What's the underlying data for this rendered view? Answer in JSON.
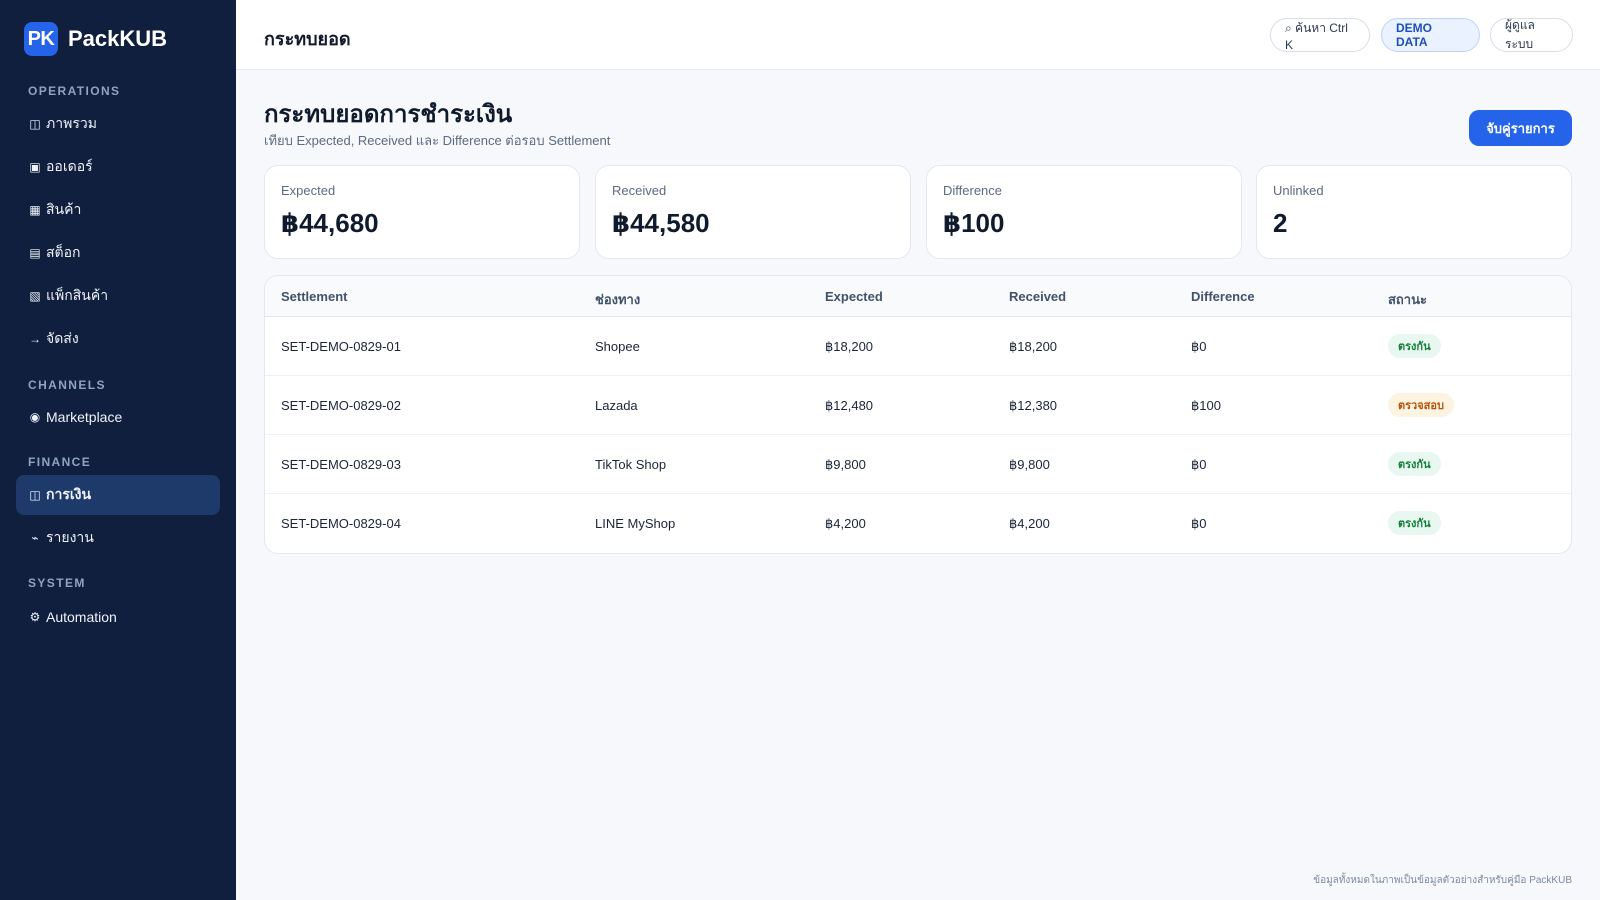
{
  "brand": {
    "mark": "PK",
    "name": "PackKUB"
  },
  "sidebar": {
    "sections": [
      {
        "label": "OPERATIONS"
      },
      {
        "label": "CHANNELS"
      },
      {
        "label": "FINANCE"
      },
      {
        "label": "SYSTEM"
      }
    ],
    "items": [
      {
        "icon": "◫",
        "label": "ภาพรวม"
      },
      {
        "icon": "▣",
        "label": "ออเดอร์"
      },
      {
        "icon": "▦",
        "label": "สินค้า"
      },
      {
        "icon": "▤",
        "label": "สต็อก"
      },
      {
        "icon": "▧",
        "label": "แพ็กสินค้า"
      },
      {
        "icon": "→",
        "label": "จัดส่ง"
      },
      {
        "icon": "◉",
        "label": "Marketplace"
      },
      {
        "icon": "◫",
        "label": "การเงิน"
      },
      {
        "icon": "⌁",
        "label": "รายงาน"
      },
      {
        "icon": "⚙",
        "label": "Automation"
      }
    ]
  },
  "topbar": {
    "title": "กระทบยอด",
    "search_label": "⌕ ค้นหา Ctrl K",
    "demo_label": "DEMO DATA",
    "user_label": "ผู้ดูแลระบบ"
  },
  "page": {
    "title": "กระทบยอดการชำระเงิน",
    "subtitle": "เทียบ Expected, Received และ Difference ต่อรอบ Settlement",
    "action_label": "จับคู่รายการ"
  },
  "cards": [
    {
      "label": "Expected",
      "value": "฿44,680"
    },
    {
      "label": "Received",
      "value": "฿44,580"
    },
    {
      "label": "Difference",
      "value": "฿100"
    },
    {
      "label": "Unlinked",
      "value": "2"
    }
  ],
  "table": {
    "headers": [
      "Settlement",
      "ช่องทาง",
      "Expected",
      "Received",
      "Difference",
      "สถานะ"
    ],
    "rows": [
      {
        "settlement": "SET-DEMO-0829-01",
        "channel": "Shopee",
        "expected": "฿18,200",
        "received": "฿18,200",
        "difference": "฿0",
        "status": "ตรงกัน",
        "status_type": "ok"
      },
      {
        "settlement": "SET-DEMO-0829-02",
        "channel": "Lazada",
        "expected": "฿12,480",
        "received": "฿12,380",
        "difference": "฿100",
        "status": "ตรวจสอบ",
        "status_type": "warn"
      },
      {
        "settlement": "SET-DEMO-0829-03",
        "channel": "TikTok Shop",
        "expected": "฿9,800",
        "received": "฿9,800",
        "difference": "฿0",
        "status": "ตรงกัน",
        "status_type": "ok"
      },
      {
        "settlement": "SET-DEMO-0829-04",
        "channel": "LINE MyShop",
        "expected": "฿4,200",
        "received": "฿4,200",
        "difference": "฿0",
        "status": "ตรงกัน",
        "status_type": "ok"
      }
    ]
  },
  "footer": {
    "note": "ข้อมูลทั้งหมดในภาพเป็นข้อมูลตัวอย่างสำหรับคู่มือ PackKUB"
  },
  "colors": {
    "sidebar": "#0f1f3d",
    "accent": "#2563eb",
    "ok": "#15803d",
    "warn": "#b45309"
  }
}
